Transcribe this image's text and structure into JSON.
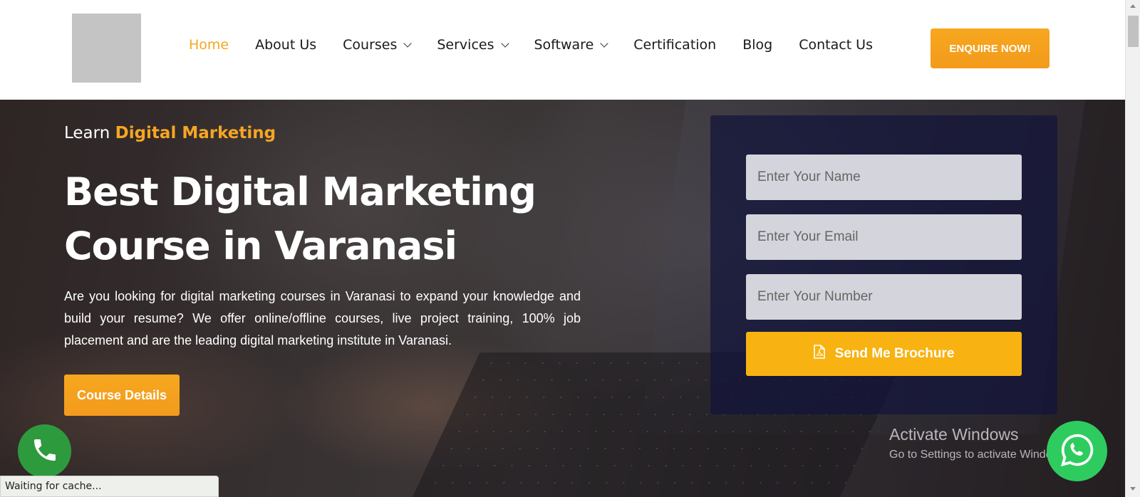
{
  "header": {
    "nav": [
      {
        "label": "Home",
        "active": true,
        "dropdown": false
      },
      {
        "label": "About Us",
        "active": false,
        "dropdown": false
      },
      {
        "label": "Courses",
        "active": false,
        "dropdown": true
      },
      {
        "label": "Services",
        "active": false,
        "dropdown": true
      },
      {
        "label": "Software",
        "active": false,
        "dropdown": true
      },
      {
        "label": "Certification",
        "active": false,
        "dropdown": false
      },
      {
        "label": "Blog",
        "active": false,
        "dropdown": false
      },
      {
        "label": "Contact Us",
        "active": false,
        "dropdown": false
      }
    ],
    "enquire_label": "ENQUIRE NOW!"
  },
  "hero": {
    "eyebrow_prefix": "Learn",
    "eyebrow_highlight": "Digital Marketing",
    "headline_line1": "Best Digital Marketing",
    "headline_line2": "Course in Varanasi",
    "description": "Are you looking for digital marketing courses in Varanasi to expand your knowledge and build your resume? We offer online/offline courses, live project training, 100% job placement and are the leading digital marketing institute in Varanasi.",
    "cta_label": "Course Details"
  },
  "form": {
    "name_placeholder": "Enter Your Name",
    "email_placeholder": "Enter Your Email",
    "number_placeholder": "Enter Your Number",
    "submit_label": "Send Me Brochure",
    "submit_icon": "pdf-file-icon"
  },
  "floating": {
    "call_icon": "phone-icon",
    "whatsapp_icon": "whatsapp-icon"
  },
  "system": {
    "activate_title": "Activate Windows",
    "activate_sub": "Go to Settings to activate Windows.",
    "status_text": "Waiting for cache..."
  },
  "colors": {
    "accent": "#f5a623",
    "brochure": "#f8b211",
    "form_panel": "#12143c",
    "call": "#2e9a3e",
    "whatsapp": "#2ecc5f"
  }
}
